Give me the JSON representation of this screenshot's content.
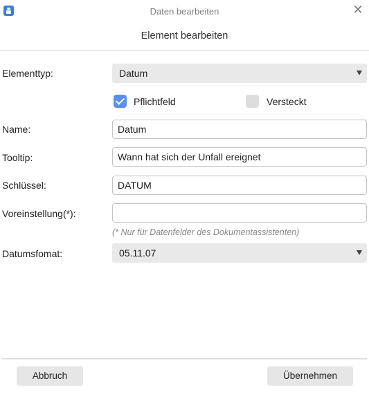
{
  "window": {
    "title": "Daten bearbeiten",
    "close_symbol": "✕"
  },
  "dialog": {
    "heading": "Element bearbeiten"
  },
  "form": {
    "element_type": {
      "label": "Elementtyp:",
      "value": "Datum"
    },
    "required": {
      "label": "Pflichtfeld",
      "checked": true
    },
    "hidden": {
      "label": "Versteckt",
      "checked": false
    },
    "name": {
      "label": "Name:",
      "value": "Datum"
    },
    "tooltip": {
      "label": "Tooltip:",
      "value": "Wann hat sich der Unfall ereignet"
    },
    "key": {
      "label": "Schlüssel:",
      "value": "DATUM"
    },
    "default": {
      "label": "Voreinstellung(*):",
      "value": ""
    },
    "hint": "(* Nur für Datenfelder des Dokumentassistenten)",
    "date_format": {
      "label": "Datumsfomat:",
      "value": "05.11.07"
    }
  },
  "footer": {
    "cancel_label": "Abbruch",
    "apply_label": "Übernehmen"
  },
  "colors": {
    "accent": "#5b8fe8",
    "select_bg": "#e9e9e9",
    "button_bg": "#e6e6e6"
  },
  "icons": [
    "app-icon",
    "close-icon",
    "dropdown-arrow-icon",
    "checkmark-icon"
  ]
}
